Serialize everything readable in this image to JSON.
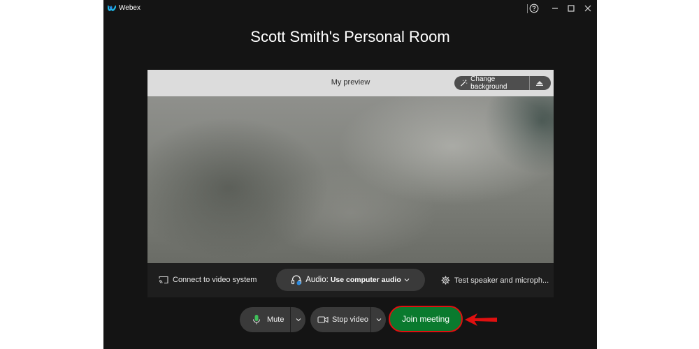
{
  "app": {
    "name": "Webex",
    "brand_colors": [
      "#1fb6e8",
      "#2c7be5"
    ]
  },
  "titlebar": {
    "icons": [
      "help-icon",
      "minimize-icon",
      "maximize-icon",
      "close-icon"
    ]
  },
  "room": {
    "title": "Scott Smith's Personal Room"
  },
  "preview": {
    "label": "My preview",
    "change_background_label": "Change background",
    "icons": [
      "magic-wand-icon",
      "background-dropdown-icon"
    ]
  },
  "controls": {
    "connect_video_label": "Connect to video system",
    "audio_prefix": "Audio:",
    "audio_value": "Use computer audio",
    "test_speaker_label": "Test speaker and microph..."
  },
  "actions": {
    "mute_label": "Mute",
    "stop_video_label": "Stop video",
    "join_label": "Join meeting",
    "join_color": "#0a7a2e",
    "highlight_color": "#e01010"
  }
}
